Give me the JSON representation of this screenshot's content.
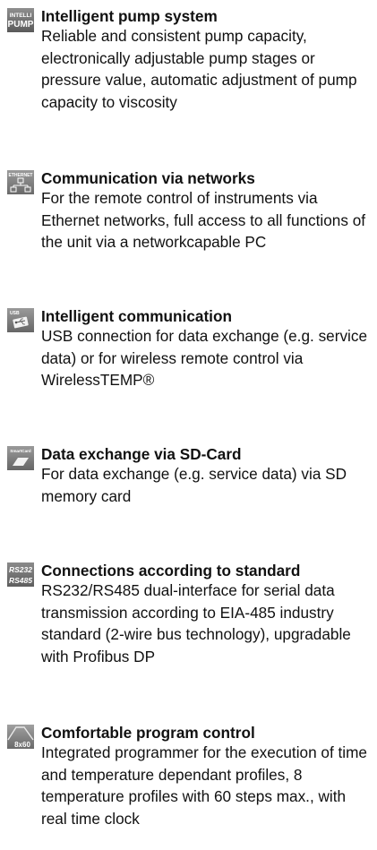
{
  "features": [
    {
      "icon": "intelli-pump-icon",
      "icon_text": [
        "INTELLI",
        "PUMP"
      ],
      "title": "Intelligent pump system",
      "description": "Reliable and consistent pump capacity, electronically adjustable pump stages or pressure value, automatic adjustment of pump capacity to viscosity"
    },
    {
      "icon": "ethernet-network-icon",
      "icon_text": [
        "ETHERNET"
      ],
      "title": "Communication via networks",
      "description": "For the remote control of instruments via Ethernet networks, full access to all functions of the unit via a networkcapable PC"
    },
    {
      "icon": "usb-icon",
      "icon_text": [
        "USB"
      ],
      "title": "Intelligent communication",
      "description": "USB connection for data exchange (e.g. service data) or for wireless remote control via WirelessTEMP®"
    },
    {
      "icon": "smartcard-icon",
      "icon_text": [
        "SmartCard"
      ],
      "title": "Data exchange via SD-Card",
      "description": "For data exchange (e.g. service data) via SD memory card"
    },
    {
      "icon": "rs232-rs485-icon",
      "icon_text": [
        "RS232",
        "RS485"
      ],
      "title": "Connections according to standard",
      "description": "RS232/RS485 dual-interface for serial data transmission according to EIA-485 industry standard (2-wire bus technology), upgradable with Profibus DP"
    },
    {
      "icon": "program-control-8x60-icon",
      "icon_text": [
        "8x60"
      ],
      "title": "Comfortable program control",
      "description": "Integrated programmer for the execution of time and temperature dependant profiles, 8 temperature profiles with 60 steps max., with real time clock"
    }
  ]
}
